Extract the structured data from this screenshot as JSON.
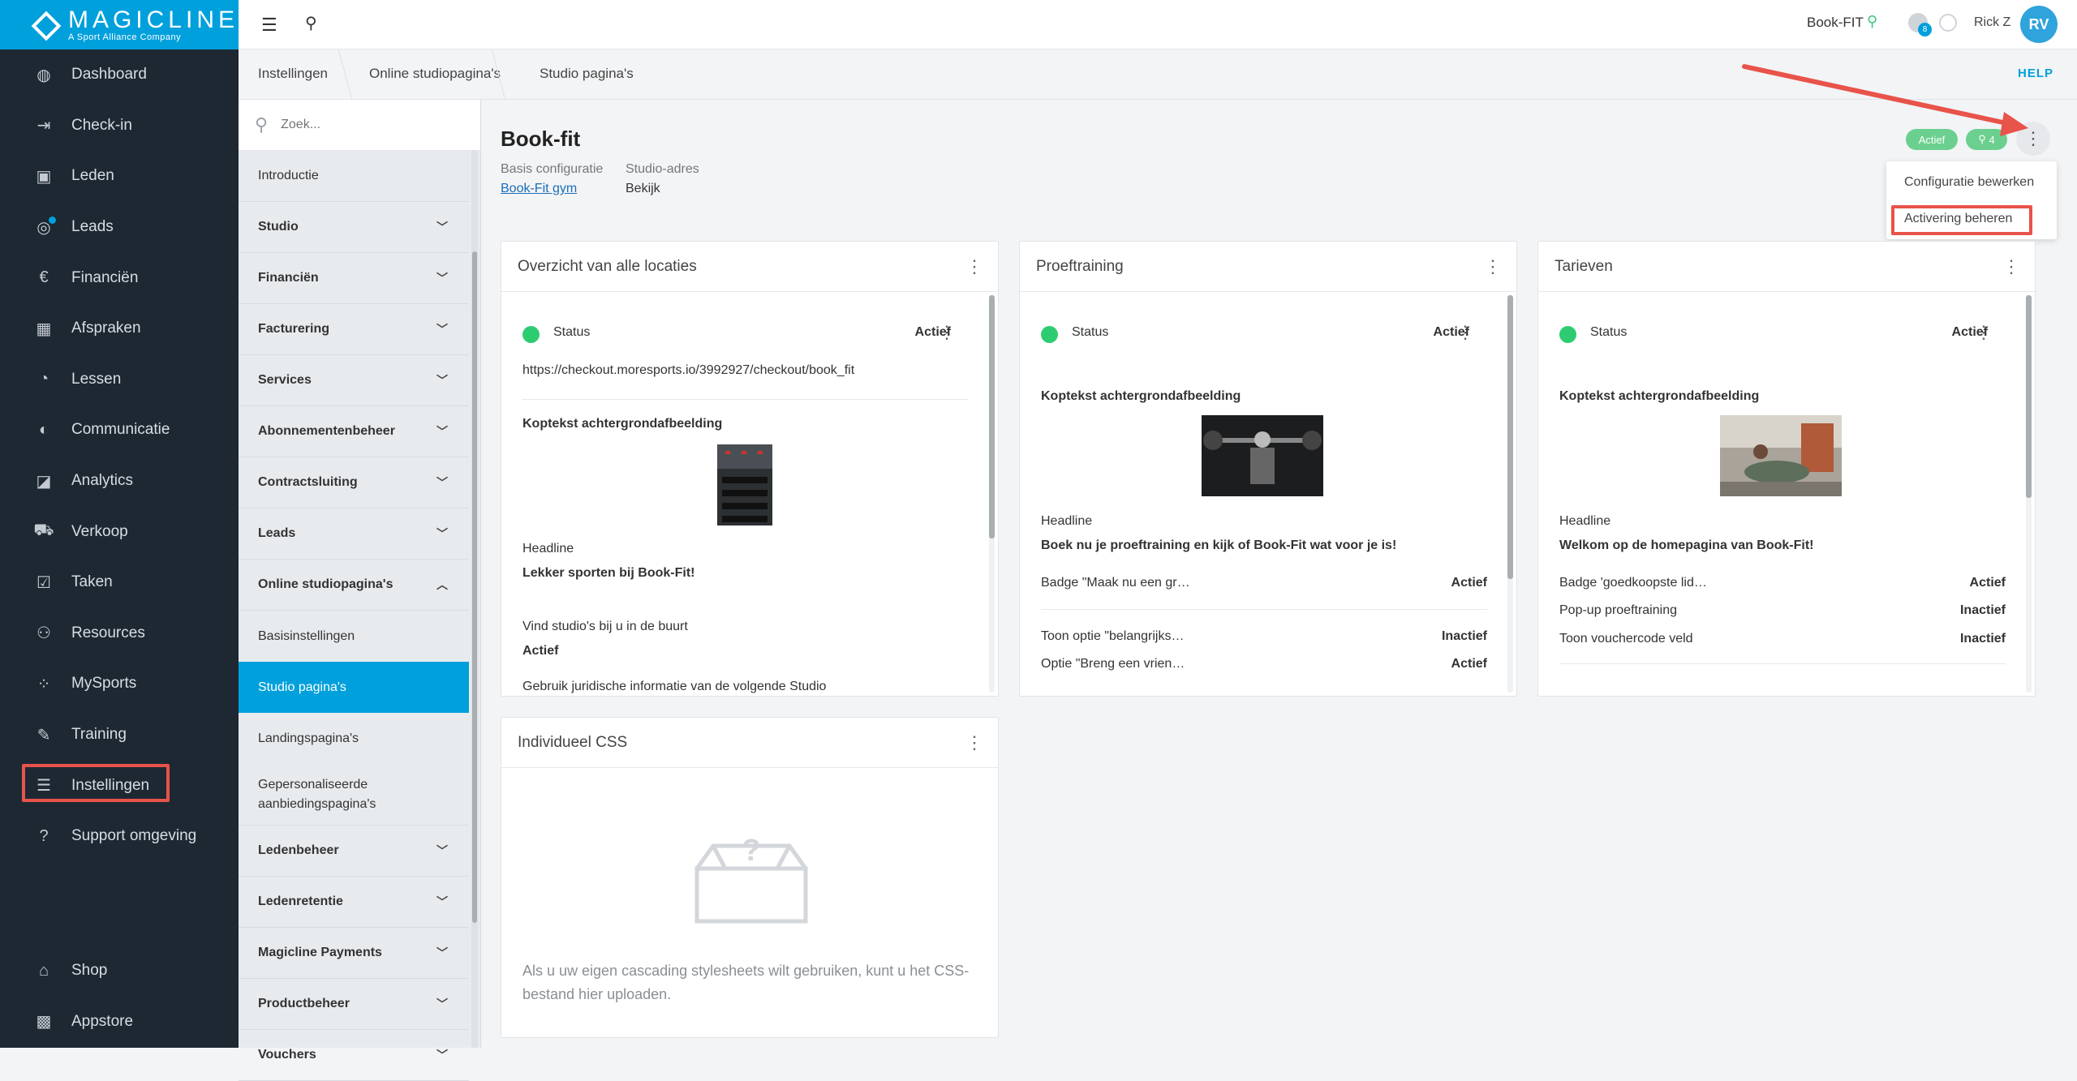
{
  "nav": {
    "brand": "MAGICLINE",
    "brand_sub": "A Sport Alliance Company",
    "items": [
      {
        "label": "Dashboard",
        "icon": "dashboard-icon",
        "glyph": "◍"
      },
      {
        "label": "Check-in",
        "icon": "checkin-icon",
        "glyph": "⇥"
      },
      {
        "label": "Leden",
        "icon": "members-icon",
        "glyph": "▣"
      },
      {
        "label": "Leads",
        "icon": "leads-icon",
        "glyph": "◎"
      },
      {
        "label": "Financiën",
        "icon": "finance-icon",
        "glyph": "€"
      },
      {
        "label": "Afspraken",
        "icon": "calendar-icon",
        "glyph": "▦"
      },
      {
        "label": "Lessen",
        "icon": "classes-icon",
        "glyph": "◔"
      },
      {
        "label": "Communicatie",
        "icon": "chat-icon",
        "glyph": "◐"
      },
      {
        "label": "Analytics",
        "icon": "analytics-icon",
        "glyph": "◪"
      },
      {
        "label": "Verkoop",
        "icon": "cart-icon",
        "glyph": "⛟"
      },
      {
        "label": "Taken",
        "icon": "tasks-icon",
        "glyph": "☑"
      },
      {
        "label": "Resources",
        "icon": "resources-icon",
        "glyph": "⚇"
      },
      {
        "label": "MySports",
        "icon": "mysports-icon",
        "glyph": "⁘"
      },
      {
        "label": "Training",
        "icon": "dumbbell-icon",
        "glyph": "✎"
      },
      {
        "label": "Instellingen",
        "icon": "settings-sliders-icon",
        "glyph": "☰"
      },
      {
        "label": "Support omgeving",
        "icon": "support-icon",
        "glyph": "?"
      }
    ],
    "bottom": [
      {
        "label": "Shop",
        "icon": "shop-icon",
        "glyph": "⌂"
      },
      {
        "label": "Appstore",
        "icon": "appstore-icon",
        "glyph": "▩"
      }
    ]
  },
  "topbar": {
    "studio": "Book-FIT",
    "notif_count": "8",
    "user": "Rick Z",
    "avatar": "RV"
  },
  "breadcrumb": [
    "Instellingen",
    "Online studiopagina's",
    "Studio pagina's"
  ],
  "help": "HELP",
  "subnav": {
    "search_placeholder": "Zoek...",
    "items": [
      {
        "label": "Introductie"
      },
      {
        "label": "Studio"
      },
      {
        "label": "Financiën"
      },
      {
        "label": "Facturering"
      },
      {
        "label": "Services"
      },
      {
        "label": "Abonnementenbeheer"
      },
      {
        "label": "Contractsluiting"
      },
      {
        "label": "Leads"
      },
      {
        "label": "Online studiopagina's"
      },
      {
        "label": "Basisinstellingen"
      },
      {
        "label": "Studio pagina's"
      },
      {
        "label": "Landingspagina's"
      },
      {
        "label": "Gepersonaliseerde aanbiedingspagina's"
      },
      {
        "label": "Ledenbeheer"
      },
      {
        "label": "Ledenretentie"
      },
      {
        "label": "Magicline Payments"
      },
      {
        "label": "Productbeheer"
      },
      {
        "label": "Vouchers"
      }
    ]
  },
  "page": {
    "title": "Book-fit",
    "basis_label": "Basis configuratie",
    "basis_value": "Book-Fit gym",
    "adres_label": "Studio-adres",
    "adres_value": "Bekijk",
    "pill_actief": "Actief",
    "pill_locations": "4"
  },
  "dropdown": {
    "edit": "Configuratie bewerken",
    "activation": "Activering beheren"
  },
  "cards": {
    "overview": {
      "title": "Overzicht van alle locaties",
      "status_label": "Status",
      "status_value": "Actief",
      "url": "https://checkout.moresports.io/3992927/checkout/book_fit",
      "bg_label": "Koptekst achtergrondafbeelding",
      "headline_label": "Headline",
      "headline_value": "Lekker sporten bij Book-Fit!",
      "nearby_label": "Vind studio's bij u in de buurt",
      "nearby_value": "Actief",
      "legal_label": "Gebruik juridische informatie van de volgende Studio"
    },
    "trial": {
      "title": "Proeftraining",
      "status_label": "Status",
      "status_value": "Actief",
      "bg_label": "Koptekst achtergrondafbeelding",
      "headline_label": "Headline",
      "headline_value": "Boek nu je proeftraining en kijk of Book-Fit wat voor je is!",
      "rows": [
        {
          "label": "Badge \"Maak nu een gr…",
          "value": "Actief"
        },
        {
          "label": "Toon optie \"belangrijks…",
          "value": "Inactief"
        },
        {
          "label": "Optie \"Breng een vrien…",
          "value": "Actief"
        }
      ]
    },
    "rates": {
      "title": "Tarieven",
      "status_label": "Status",
      "status_value": "Actief",
      "bg_label": "Koptekst achtergrondafbeelding",
      "headline_label": "Headline",
      "headline_value": "Welkom op de homepagina van Book-Fit!",
      "rows": [
        {
          "label": "Badge 'goedkoopste lid…",
          "value": "Actief"
        },
        {
          "label": "Pop-up proeftraining",
          "value": "Inactief"
        },
        {
          "label": "Toon vouchercode veld",
          "value": "Inactief"
        }
      ]
    },
    "css": {
      "title": "Individueel CSS",
      "empty_text": "Als u uw eigen cascading stylesheets wilt gebruiken, kunt u het CSS-bestand hier uploaden."
    }
  },
  "colors": {
    "accent": "#00a0dc",
    "nav_bg": "#1d2833",
    "status_green": "#2ecc71",
    "highlight_red": "#e8534a"
  }
}
